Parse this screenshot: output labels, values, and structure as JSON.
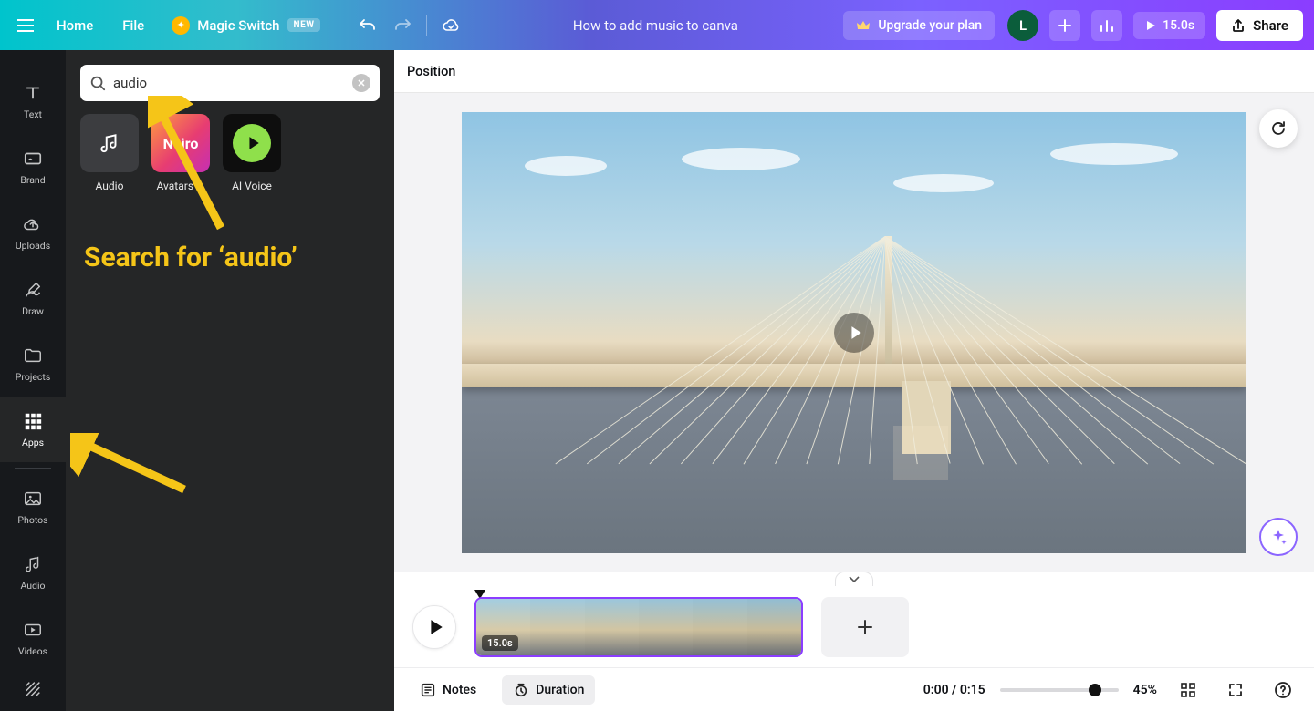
{
  "topbar": {
    "home": "Home",
    "file": "File",
    "magic_switch": "Magic Switch",
    "new_badge": "NEW",
    "doc_title": "How to add music to canva",
    "upgrade": "Upgrade your plan",
    "avatar_initial": "L",
    "duration": "15.0s",
    "share": "Share"
  },
  "rail": {
    "items": [
      "Text",
      "Brand",
      "Uploads",
      "Draw",
      "Projects",
      "Apps",
      "Photos",
      "Audio",
      "Videos"
    ],
    "active_index": 5
  },
  "panel": {
    "search_value": "audio",
    "results": [
      {
        "label": "Audio",
        "type": "audio"
      },
      {
        "label": "Avatars ...",
        "type": "neiro",
        "thumb_text": "Neiro"
      },
      {
        "label": "AI Voice",
        "type": "aivoice"
      }
    ],
    "annotation": "Search for ‘audio’"
  },
  "options_bar": {
    "position": "Position"
  },
  "timeline": {
    "clip_duration": "15.0s"
  },
  "bottom": {
    "notes": "Notes",
    "duration": "Duration",
    "time": "0:00 / 0:15",
    "zoom": "45%"
  }
}
